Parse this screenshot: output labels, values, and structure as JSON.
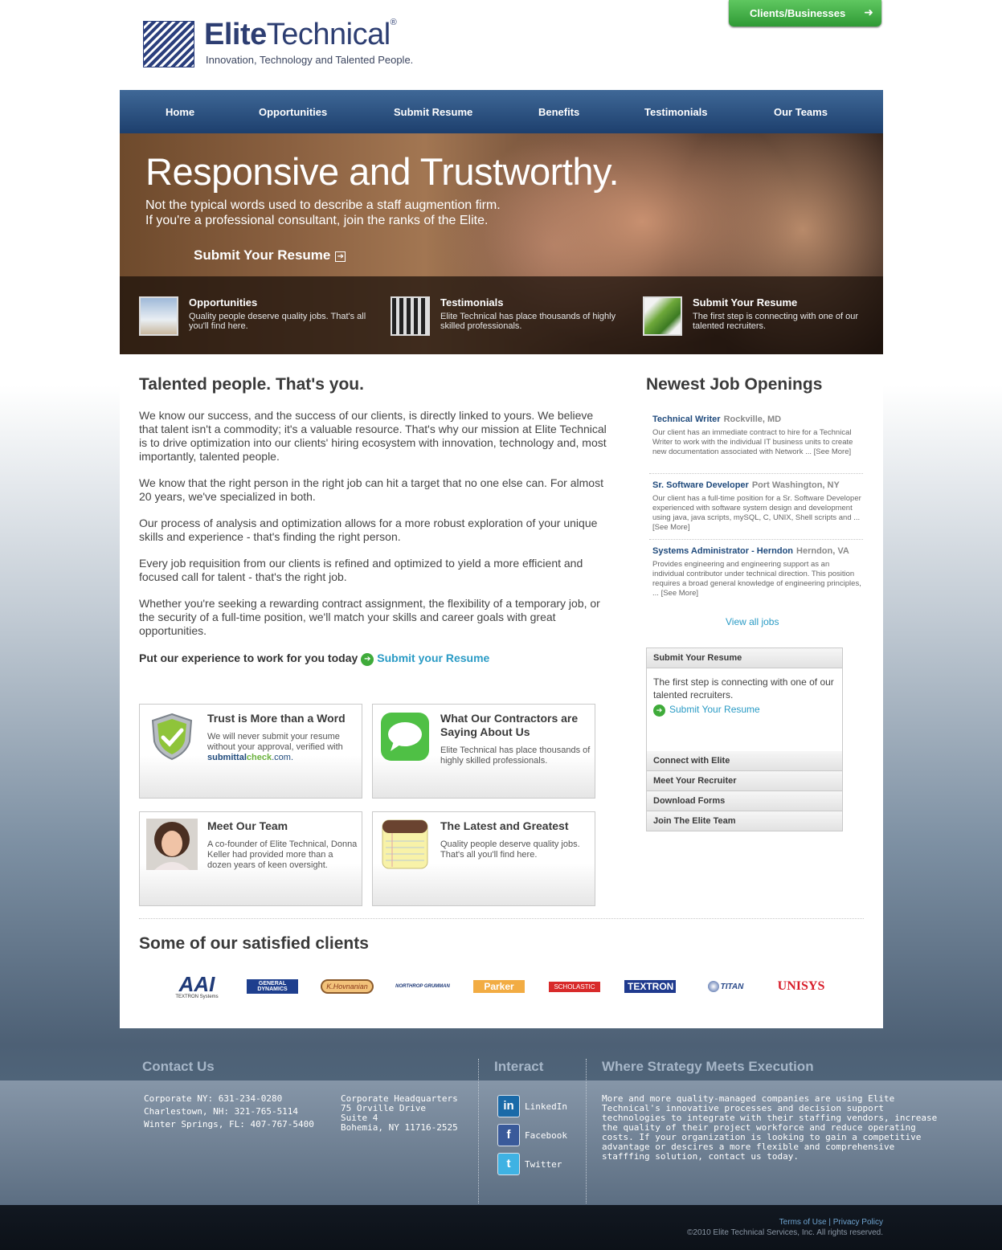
{
  "brand": {
    "name_bold": "Elite",
    "name_light": "Technical",
    "registered": "®",
    "tagline": "Innovation, Technology and Talented People.",
    "primary_color": "#2d3e72"
  },
  "header": {
    "clients_button": "Clients/Businesses",
    "clients_button_arrow": "➜",
    "clients_button_color": "#3aa53f"
  },
  "nav": {
    "items": [
      "Home",
      "Opportunities",
      "Submit Resume",
      "Benefits",
      "Testimonials",
      "Our Teams"
    ],
    "color": "#2b5185"
  },
  "hero": {
    "title": "Responsive and Trustworthy.",
    "subtitle_line1": "Not the typical words used to describe a staff augmention firm.",
    "subtitle_line2": "If you're a professional consultant, join the ranks of the Elite.",
    "cta": "Submit Your Resume",
    "cta_icon": "➔",
    "features": [
      {
        "title": "Opportunities",
        "text": "Quality people deserve quality jobs. That's all you'll find here.",
        "icon": "binoculars-photo"
      },
      {
        "title": "Testimonials",
        "text": "Elite Technical has place thousands of highly skilled professionals.",
        "icon": "crowd-photo"
      },
      {
        "title": "Submit Your Resume",
        "text": "The first step is connecting with one of our talented recruiters.",
        "icon": "leaf-photo"
      }
    ]
  },
  "main": {
    "heading": "Talented people. That's you.",
    "paragraphs": [
      "We know our success, and the success of our clients, is directly linked to yours. We believe that talent isn't a commodity; it's a valuable resource. That's why our mission at Elite Technical is to drive optimization into our clients' hiring ecosystem with innovation, technology and, most importantly, talented people.",
      "We know that the right person in the right job can hit a target that no one else can. For almost 20 years, we've specialized in both.",
      "Our process of analysis and optimization allows for a more robust exploration of your unique skills and experience - that's finding the right person.",
      "Every job requisition from our clients is refined and optimized to yield a more efficient and focused call for talent - that's the right job.",
      "Whether you're seeking a rewarding contract assignment, the flexibility of a temporary job, or the security of a full-time position, we'll match your skills and career goals with great opportunities."
    ],
    "cta_text": "Put our experience to work for you today",
    "cta_link": "Submit your Resume",
    "cta_icon": "➔"
  },
  "features": [
    {
      "title": "Trust is More than a Word",
      "text": "We will never submit your resume without your approval, verified with",
      "brand_a": "submittal",
      "brand_b": "check",
      "brand_c": ".com.",
      "icon": "shield-check-icon"
    },
    {
      "title": "What Our Contractors are Saying About Us",
      "text": "Elite Technical has place thousands of highly skilled professionals.",
      "icon": "chat-bubble-icon"
    },
    {
      "title": "Meet Our Team",
      "text": "A co-founder of Elite Technical, Donna Keller had provided more than a dozen years of keen oversight.",
      "icon": "portrait-photo"
    },
    {
      "title": "The Latest and Greatest",
      "text": "Quality people deserve quality jobs. That's all you'll find here.",
      "icon": "notepad-icon"
    }
  ],
  "jobs": {
    "heading": "Newest Job Openings",
    "items": [
      {
        "title": "Technical Writer",
        "location": "Rockville, MD",
        "desc": "Our client has an immediate contract to hire for a Technical Writer to work with the individual IT business units to create new documentation associated with Network ...",
        "more": "[See More]"
      },
      {
        "title": "Sr. Software Developer",
        "location": "Port Washington, NY",
        "desc": "Our client has a full-time position for a Sr. Software Developer experienced with software system design and development using java, java scripts, mySQL, C, UNIX, Shell scripts and ...",
        "more": "[See More]"
      },
      {
        "title": "Systems Administrator - Herndon",
        "location": "Herndon, VA",
        "desc": "Provides engineering and engineering support as an individual contributor under technical direction. This position requires a broad general knowledge of engineering principles, ...",
        "more": "[See More]"
      }
    ],
    "view_all": "View all jobs"
  },
  "sidebar": {
    "box_title": "Submit Your Resume",
    "box_text": "The first step is connecting with one of our talented recruiters.",
    "box_link": "Submit Your Resume",
    "box_link_icon": "➔",
    "links": [
      "Connect with Elite",
      "Meet Your Recruiter",
      "Download Forms",
      "Join The Elite Team"
    ]
  },
  "clients": {
    "heading": "Some of our satisfied clients",
    "logos": [
      "AAI",
      "TEXTRON Systems",
      "GENERAL DYNAMICS",
      "K.Hovnanian",
      "NORTHROP GRUMMAN",
      "Parker",
      "SCHOLASTIC",
      "TEXTRON",
      "TITAN",
      "UNISYS"
    ]
  },
  "footer": {
    "contact": {
      "heading": "Contact Us",
      "phones": [
        "Corporate NY: 631-234-0280",
        "Charlestown, NH: 321-765-5114",
        "Winter Springs, FL: 407-767-5400"
      ],
      "address": [
        "Corporate Headquarters",
        "75 Orville Drive",
        "Suite 4",
        "Bohemia, NY 11716-2525"
      ]
    },
    "interact": {
      "heading": "Interact",
      "items": [
        {
          "label": "LinkedIn",
          "glyph": "in",
          "color": "#1a6aa8"
        },
        {
          "label": "Facebook",
          "glyph": "f",
          "color": "#3a5a9a"
        },
        {
          "label": "Twitter",
          "glyph": "t",
          "color": "#3fb2e3"
        }
      ]
    },
    "strategy": {
      "heading": "Where Strategy Meets Execution",
      "text_lines": [
        "More and more quality-managed companies are using Elite",
        "Technical's innovative processes and decision support",
        "technologies to integrate with their staffing vendors, increase",
        "the quality of their project workforce and reduce operating",
        "costs. If your organization is looking to gain a competitive",
        "advantage or descires a more flexible and comprehensive",
        "stafffing solution, contact us today."
      ]
    },
    "legal": {
      "terms": "Terms of Use",
      "sep": "|",
      "privacy": "Privacy Policy"
    },
    "copyright": "©2010 Elite Technical Services, Inc. All rights reserved."
  }
}
